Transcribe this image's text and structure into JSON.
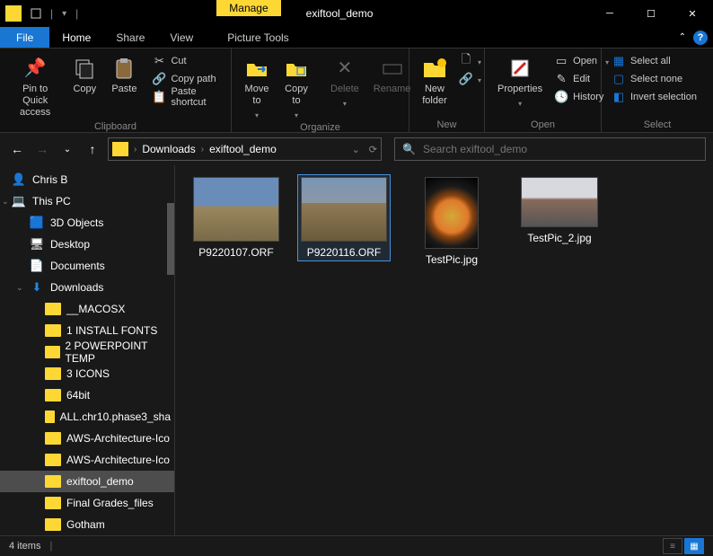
{
  "window": {
    "title": "exiftool_demo"
  },
  "tabs": {
    "contextual": "Manage",
    "picture_tools": "Picture Tools"
  },
  "menu": {
    "file": "File",
    "home": "Home",
    "share": "Share",
    "view": "View"
  },
  "ribbon": {
    "pin": "Pin to Quick\naccess",
    "copy": "Copy",
    "paste": "Paste",
    "cut": "Cut",
    "copy_path": "Copy path",
    "paste_shortcut": "Paste shortcut",
    "clipboard_label": "Clipboard",
    "move_to": "Move\nto",
    "copy_to": "Copy\nto",
    "delete": "Delete",
    "rename": "Rename",
    "organize_label": "Organize",
    "new_folder": "New\nfolder",
    "new_label": "New",
    "properties": "Properties",
    "open": "Open",
    "edit": "Edit",
    "history": "History",
    "open_label": "Open",
    "select_all": "Select all",
    "select_none": "Select none",
    "invert_selection": "Invert selection",
    "select_label": "Select"
  },
  "breadcrumb": {
    "downloads": "Downloads",
    "folder": "exiftool_demo"
  },
  "search": {
    "placeholder": "Search exiftool_demo"
  },
  "tree": {
    "user": "Chris B",
    "thispc": "This PC",
    "items": [
      "3D Objects",
      "Desktop",
      "Documents",
      "Downloads"
    ],
    "subitems": [
      "__MACOSX",
      "1 INSTALL FONTS",
      "2 POWERPOINT TEMP",
      "3 ICONS",
      "64bit",
      "ALL.chr10.phase3_sha",
      "AWS-Architecture-Ico",
      "AWS-Architecture-Ico",
      "exiftool_demo",
      "Final Grades_files",
      "Gotham"
    ]
  },
  "files": [
    {
      "name": "P9220107.ORF"
    },
    {
      "name": "P9220116.ORF"
    },
    {
      "name": "TestPic.jpg"
    },
    {
      "name": "TestPic_2.jpg"
    }
  ],
  "status": {
    "count": "4 items"
  }
}
